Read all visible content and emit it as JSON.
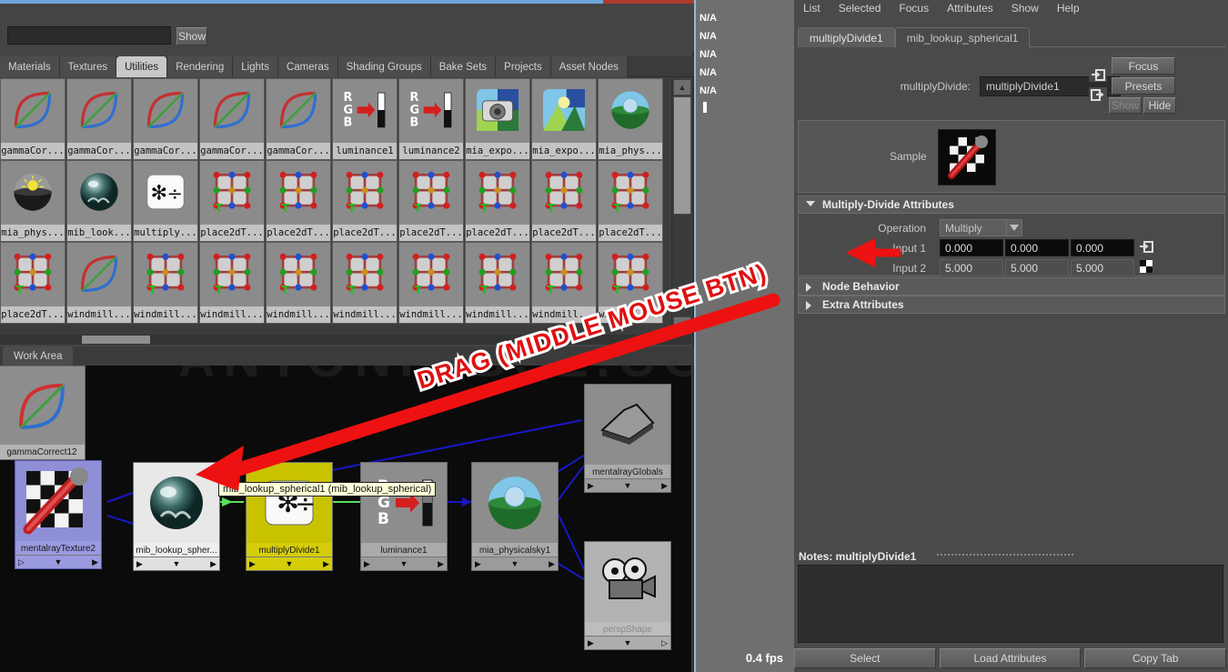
{
  "app": {
    "title": "Maya Hypershade / Attribute Editor"
  },
  "browser": {
    "search": {
      "value": "",
      "placeholder": ""
    },
    "show_button": "Show",
    "tabs": [
      {
        "label": "Materials",
        "active": false
      },
      {
        "label": "Textures",
        "active": false
      },
      {
        "label": "Utilities",
        "active": true
      },
      {
        "label": "Rendering",
        "active": false
      },
      {
        "label": "Lights",
        "active": false
      },
      {
        "label": "Cameras",
        "active": false
      },
      {
        "label": "Shading Groups",
        "active": false
      },
      {
        "label": "Bake Sets",
        "active": false
      },
      {
        "label": "Projects",
        "active": false
      },
      {
        "label": "Asset Nodes",
        "active": false
      }
    ],
    "nodes_row1": [
      {
        "label": "gammaCor...",
        "icon": "gamma-correct-icon"
      },
      {
        "label": "gammaCor...",
        "icon": "gamma-correct-icon"
      },
      {
        "label": "gammaCor...",
        "icon": "gamma-correct-icon"
      },
      {
        "label": "gammaCor...",
        "icon": "gamma-correct-icon"
      },
      {
        "label": "gammaCor...",
        "icon": "gamma-correct-icon"
      },
      {
        "label": "luminance1",
        "icon": "luminance-icon"
      },
      {
        "label": "luminance2",
        "icon": "luminance-icon"
      },
      {
        "label": "mia_expo...",
        "icon": "camera-exposure-icon"
      },
      {
        "label": "mia_expo...",
        "icon": "landscape-exposure-icon"
      },
      {
        "label": "mia_phys...",
        "icon": "physical-sky-icon"
      }
    ],
    "nodes_row2": [
      {
        "label": "mia_phys...",
        "icon": "physical-sun-icon"
      },
      {
        "label": "mib_look...",
        "icon": "lookup-sphere-icon"
      },
      {
        "label": "multiply...",
        "icon": "multiply-divide-icon"
      },
      {
        "label": "place2dT...",
        "icon": "place2d-texture-icon"
      },
      {
        "label": "place2dT...",
        "icon": "place2d-texture-icon"
      },
      {
        "label": "place2dT...",
        "icon": "place2d-texture-icon"
      },
      {
        "label": "place2dT...",
        "icon": "place2d-texture-icon"
      },
      {
        "label": "place2dT...",
        "icon": "place2d-texture-icon"
      },
      {
        "label": "place2dT...",
        "icon": "place2d-texture-icon"
      },
      {
        "label": "place2dT...",
        "icon": "place2d-texture-icon"
      }
    ],
    "nodes_row3": [
      {
        "label": "place2dT...",
        "icon": "place2d-texture-icon"
      },
      {
        "label": "windmill...",
        "icon": "gamma-correct-icon"
      },
      {
        "label": "windmill...",
        "icon": "place2d-texture-icon"
      },
      {
        "label": "windmill...",
        "icon": "place2d-texture-icon"
      },
      {
        "label": "windmill...",
        "icon": "place2d-texture-icon"
      },
      {
        "label": "windmill...",
        "icon": "place2d-texture-icon"
      },
      {
        "label": "windmill...",
        "icon": "place2d-texture-icon"
      },
      {
        "label": "windmill...",
        "icon": "place2d-texture-icon"
      },
      {
        "label": "windmill...",
        "icon": "place2d-texture-icon"
      },
      {
        "label": "windmill...",
        "icon": "place2d-texture-icon"
      }
    ],
    "work_area_tab": "Work Area",
    "watermark": "ANTONIOBSL.COM"
  },
  "graph": {
    "annotation": "DRAG (MIDDLE MOUSE BTN)",
    "tooltip": "mib_lookup_spherical1 (mib_lookup_spherical)",
    "nodes": [
      {
        "name": "gammaCorrect12",
        "icon": "gamma-correct-icon",
        "style": "plain"
      },
      {
        "name": "mentalrayTexture2",
        "icon": "checker-wrench-icon",
        "style": "selected"
      },
      {
        "name": "mib_lookup_spher...",
        "icon": "lookup-sphere-icon",
        "style": "white"
      },
      {
        "name": "multiplyDivide1",
        "icon": "multiply-divide-icon",
        "style": "yellow"
      },
      {
        "name": "luminance1",
        "icon": "luminance-icon",
        "style": "plain"
      },
      {
        "name": "mia_physicalsky1",
        "icon": "physical-sky-icon",
        "style": "plain"
      },
      {
        "name": "mentalrayGlobals",
        "icon": "globals-icon",
        "style": "plain"
      },
      {
        "name": "perspShape",
        "icon": "camera-icon",
        "style": "dim"
      }
    ]
  },
  "middle_strip": {
    "values": [
      "N/A",
      "N/A",
      "N/A",
      "N/A",
      "N/A"
    ],
    "fps": "0.4 fps"
  },
  "attribute_editor": {
    "menu": [
      "List",
      "Selected",
      "Focus",
      "Attributes",
      "Show",
      "Help"
    ],
    "tabs": [
      {
        "label": "multiplyDivide1",
        "active": true
      },
      {
        "label": "mib_lookup_spherical1",
        "active": false
      }
    ],
    "node_type_label": "multiplyDivide:",
    "node_name": "multiplyDivide1",
    "focus_button": "Focus",
    "presets_button": "Presets",
    "show_button": "Show",
    "hide_button": "Hide",
    "sample_label": "Sample",
    "sections": [
      {
        "title": "Multiply-Divide Attributes",
        "expanded": true
      },
      {
        "title": "Node Behavior",
        "expanded": false
      },
      {
        "title": "Extra Attributes",
        "expanded": false
      }
    ],
    "operation_label": "Operation",
    "operation_value": "Multiply",
    "input1_label": "Input 1",
    "input1": [
      "0.000",
      "0.000",
      "0.000"
    ],
    "input2_label": "Input 2",
    "input2": [
      "5.000",
      "5.000",
      "5.000"
    ],
    "notes_label": "Notes:  multiplyDivide1",
    "buttons": [
      "Select",
      "Load Attributes",
      "Copy Tab"
    ]
  }
}
